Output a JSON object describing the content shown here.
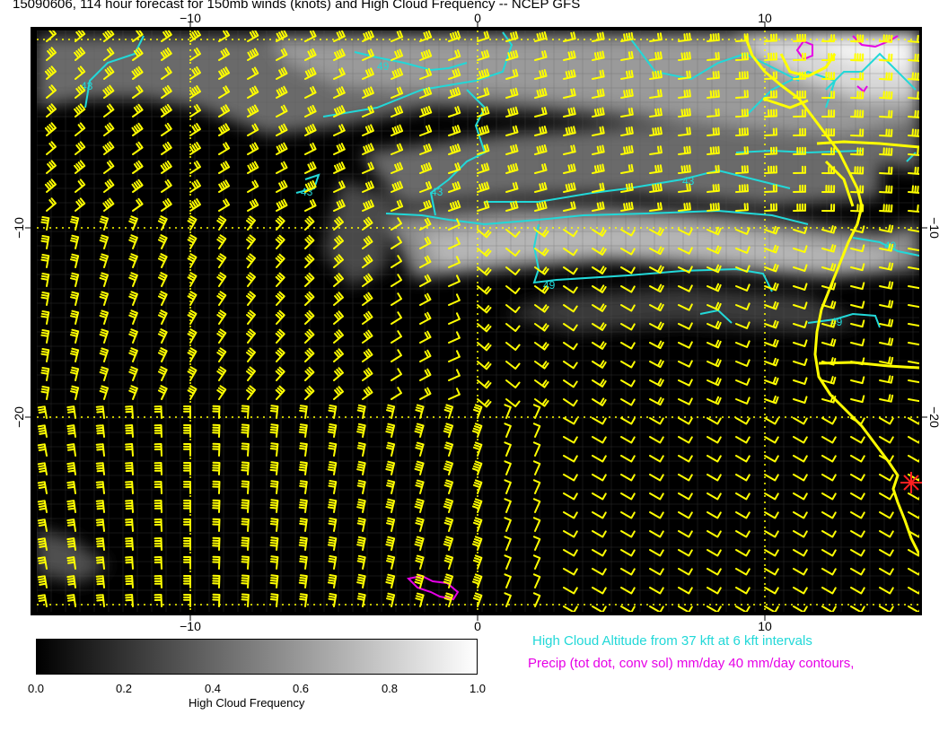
{
  "title": "15090606, 114 hour forecast for 150mb winds (knots) and High Cloud Frequency -- NCEP GFS",
  "axes": {
    "top_ticks": [
      "−10",
      "0",
      "10"
    ],
    "bottom_ticks": [
      "−10",
      "0",
      "10"
    ],
    "left_ticks": [
      "−10",
      "−20"
    ],
    "right_ticks": [
      "−10",
      "−20"
    ]
  },
  "contour_labels": [
    "49",
    "43",
    "43",
    "43",
    "49",
    "49",
    "49",
    "43"
  ],
  "colorbar": {
    "title": "High Cloud Frequency",
    "ticks": [
      "0.0",
      "0.2",
      "0.4",
      "0.6",
      "0.8",
      "1.0"
    ],
    "range": [
      0,
      1
    ]
  },
  "legend": {
    "cloud_altitude": {
      "text": "High Cloud Altitude from 37 kft at 6 kft intervals",
      "color": "#22d8d8"
    },
    "precip": {
      "text": "Precip (tot dot, conv sol) mm/day 40 mm/day contours,",
      "color": "#e600e6"
    }
  },
  "colors": {
    "wind_barbs": "#ffff00",
    "coastline": "#ffff00",
    "marker": "#ff2020",
    "grid": "#ffff00"
  },
  "marker_icon": "asterisk-marker"
}
